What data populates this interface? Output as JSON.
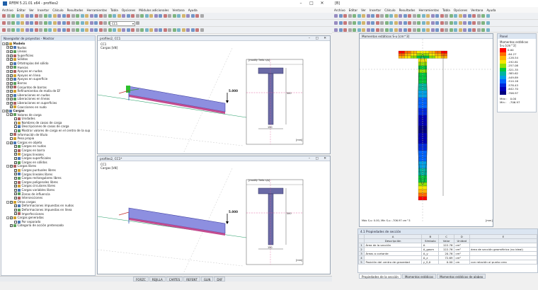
{
  "left_window": {
    "title": "RFEM 5.21.01 x64 - profiles2",
    "menu": [
      "Archivo",
      "Editar",
      "Ver",
      "Insertar",
      "Cálculo",
      "Resultados",
      "Herramientas",
      "Tabla",
      "Opciones",
      "Módulos adicionales",
      "Ventana",
      "Ayuda"
    ],
    "combo_value": "CC1",
    "navigator": {
      "title": "Navegador de proyectos - Mostrar",
      "tree": [
        {
          "label": "Modelo",
          "lvl": 0,
          "exp": "-",
          "cb": true,
          "bold": true
        },
        {
          "label": "Nudos",
          "lvl": 1,
          "exp": "+",
          "cb": true
        },
        {
          "label": "Líneas",
          "lvl": 1,
          "exp": "+",
          "cb": true
        },
        {
          "label": "Superficies",
          "lvl": 1,
          "exp": "+",
          "cb": true
        },
        {
          "label": "Sólidos",
          "lvl": 1,
          "exp": "+",
          "cb": true
        },
        {
          "label": "Ortotropías del sólido",
          "lvl": 1,
          "exp": "",
          "cb": true
        },
        {
          "label": "Huecos",
          "lvl": 1,
          "exp": "+",
          "cb": true
        },
        {
          "label": "Apoyos en nudos",
          "lvl": 1,
          "exp": "+",
          "cb": true
        },
        {
          "label": "Apoyos en línea",
          "lvl": 1,
          "exp": "+",
          "cb": true
        },
        {
          "label": "Apoyos en superficie",
          "lvl": 1,
          "exp": "+",
          "cb": true
        },
        {
          "label": "Barras",
          "lvl": 1,
          "exp": "+",
          "cb": true
        },
        {
          "label": "Conjuntos de barras",
          "lvl": 1,
          "exp": "+",
          "cb": true
        },
        {
          "label": "Refinamientos de malla de EF",
          "lvl": 1,
          "exp": "+",
          "cb": true
        },
        {
          "label": "Liberaciones en nudos",
          "lvl": 1,
          "exp": "+",
          "cb": true
        },
        {
          "label": "Liberaciones en líneas",
          "lvl": 1,
          "exp": "+",
          "cb": true
        },
        {
          "label": "Liberaciones en superficies",
          "lvl": 1,
          "exp": "+",
          "cb": true
        },
        {
          "label": "Coacciones en nudo",
          "lvl": 1,
          "exp": "",
          "cb": true
        },
        {
          "label": "Cargas",
          "lvl": 0,
          "exp": "-",
          "cb": true,
          "bold": true
        },
        {
          "label": "Valores de carga",
          "lvl": 1,
          "exp": "-",
          "cb": true
        },
        {
          "label": "Unidades",
          "lvl": 2,
          "exp": "",
          "cb": false
        },
        {
          "label": "Nombres de casos de carga",
          "lvl": 2,
          "exp": "",
          "cb": false
        },
        {
          "label": "Descripciones de casos de carga",
          "lvl": 2,
          "exp": "",
          "cb": false
        },
        {
          "label": "Mostrar valores de carga en el centro de la sup",
          "lvl": 2,
          "exp": "",
          "cb": false
        },
        {
          "label": "Información de título",
          "lvl": 1,
          "exp": "",
          "cb": true
        },
        {
          "label": "Peso propio",
          "lvl": 1,
          "exp": "",
          "cb": false
        },
        {
          "label": "Cargas en objeto",
          "lvl": 1,
          "exp": "-",
          "cb": true
        },
        {
          "label": "Cargas en nudos",
          "lvl": 2,
          "exp": "",
          "cb": true
        },
        {
          "label": "Cargas en barra",
          "lvl": 2,
          "exp": "",
          "cb": true
        },
        {
          "label": "Cargas lineales",
          "lvl": 2,
          "exp": "",
          "cb": true
        },
        {
          "label": "Cargas superficiales",
          "lvl": 2,
          "exp": "",
          "cb": true
        },
        {
          "label": "Cargas en sólidos",
          "lvl": 2,
          "exp": "",
          "cb": true
        },
        {
          "label": "Cargas libres",
          "lvl": 1,
          "exp": "-",
          "cb": true
        },
        {
          "label": "Cargas puntuales libres",
          "lvl": 2,
          "exp": "",
          "cb": true
        },
        {
          "label": "Cargas lineales libres",
          "lvl": 2,
          "exp": "",
          "cb": true
        },
        {
          "label": "Cargas rectangulares libres",
          "lvl": 2,
          "exp": "",
          "cb": true
        },
        {
          "label": "Cargas poligonales libres",
          "lvl": 2,
          "exp": "",
          "cb": true
        },
        {
          "label": "Cargas circulares libres",
          "lvl": 2,
          "exp": "",
          "cb": true
        },
        {
          "label": "Cargas variables libres",
          "lvl": 2,
          "exp": "",
          "cb": true
        },
        {
          "label": "Zonas de influencia",
          "lvl": 2,
          "exp": "",
          "cb": true
        },
        {
          "label": "Intersecciones",
          "lvl": 2,
          "exp": "",
          "cb": true
        },
        {
          "label": "Otras cargas",
          "lvl": 1,
          "exp": "-",
          "cb": true
        },
        {
          "label": "Deformaciones impuestas en nudos",
          "lvl": 2,
          "exp": "",
          "cb": true
        },
        {
          "label": "Deformaciones impuestas en línea",
          "lvl": 2,
          "exp": "",
          "cb": true
        },
        {
          "label": "Imperfecciones",
          "lvl": 2,
          "exp": "",
          "cb": true
        },
        {
          "label": "Cargas generadas",
          "lvl": 1,
          "exp": "-",
          "cb": true
        },
        {
          "label": "Por separado",
          "lvl": 2,
          "exp": "",
          "cb": false
        },
        {
          "label": "Categoría de acción pretensado",
          "lvl": 1,
          "exp": "",
          "cb": true
        }
      ],
      "tabs": [
        "Datos",
        "Mostrar",
        "Vistas"
      ]
    },
    "view1": {
      "title": "profiles2, CC1",
      "lbl1": "CC1",
      "lbl2": "Cargas [kN]",
      "load": "5.000",
      "section_title": "[modify Trefo n/p]",
      "unit": "[mm]",
      "dim_h": "300",
      "dim_w": "150"
    },
    "view2": {
      "title": "profiles2, CC1*",
      "lbl1": "CC1",
      "lbl2": "Cargas [kN]",
      "load": "5.000",
      "section_title": "[modify Trefo n/p]",
      "unit": "[mm]",
      "dim_h": "300",
      "dim_w": "150"
    },
    "status_tabs": [
      "FORZC",
      "REJILLA",
      "CARTES",
      "REFENT",
      "GLIN",
      "DXF"
    ]
  },
  "right_window": {
    "title": "[B]",
    "menu": [
      "Archivo",
      "Editar",
      "Ver",
      "Insertar",
      "Cálculo",
      "Resultados",
      "Herramientas",
      "Tabla",
      "Opciones",
      "Ventana",
      "Ayuda"
    ],
    "view": {
      "title": "Momentos estáticos S-u [cm^3]",
      "footer": "Máx S-u: 0.00, Mín S-u: -706.97 cm^3",
      "unit": "[mm]"
    },
    "panel": {
      "title": "Panel",
      "heading": "Momentos estáticos",
      "subheading": "S-u [cm^3]",
      "legend": [
        {
          "value": "0.00",
          "color": "#ff0000"
        },
        {
          "value": "-64.27",
          "color": "#ff6a00"
        },
        {
          "value": "-128.54",
          "color": "#ffb400"
        },
        {
          "value": "-192.81",
          "color": "#f5e600"
        },
        {
          "value": "-257.08",
          "color": "#8fe000"
        },
        {
          "value": "-321.35",
          "color": "#00c83c"
        },
        {
          "value": "-385.62",
          "color": "#00b4a0"
        },
        {
          "value": "-449.89",
          "color": "#00a0e6"
        },
        {
          "value": "-514.16",
          "color": "#0064ff"
        },
        {
          "value": "-578.43",
          "color": "#0028dc"
        },
        {
          "value": "-642.70",
          "color": "#0000b4"
        },
        {
          "value": "-706.97",
          "color": "#000080"
        }
      ],
      "max_label": "Máx :",
      "max_value": "0.00",
      "min_label": "Mín :",
      "min_value": "-706.97"
    },
    "table": {
      "title": "4.1 Propiedades de sección",
      "col_letters": [
        "A",
        "B",
        "C",
        "D",
        "E"
      ],
      "headers": [
        "",
        "Descripción",
        "Símbolo",
        "Valor",
        "Unidad",
        ""
      ],
      "rows": [
        [
          "1",
          "Área de la sección",
          "A",
          "122.76",
          "cm²",
          ""
        ],
        [
          "2",
          "",
          "A_gasm",
          "122.76",
          "cm²",
          "área de sección geométrica (no ideal)"
        ],
        [
          "3",
          "Áreas a cortante",
          "A_y",
          "20.76",
          "cm²",
          ""
        ],
        [
          "4",
          "",
          "A_z",
          "72.69",
          "cm²",
          ""
        ],
        [
          "5",
          "Posición del centro de gravedad",
          "y_S,0",
          "0.00",
          "cm",
          "con relación al punto cero"
        ]
      ],
      "tabs": [
        "Propiedades de la sección",
        "Momentos estáticos",
        "Momentos estáticos de alabeo"
      ]
    }
  }
}
